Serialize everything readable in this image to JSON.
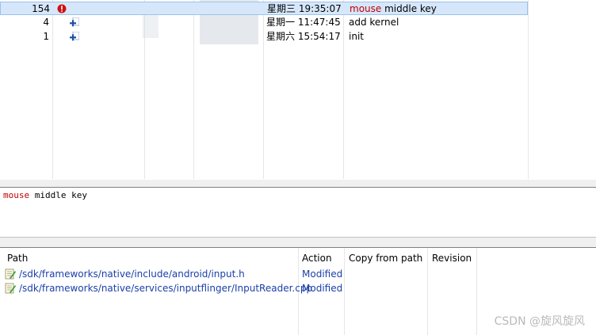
{
  "revisions": [
    {
      "number": "154",
      "icon": "error-icon",
      "date": "星期三 19:35:07",
      "message_keyword": "mouse",
      "message_rest": " middle key",
      "selected": true
    },
    {
      "number": "4",
      "icon": "add-icon",
      "date": "星期一 11:47:45",
      "message_keyword": "",
      "message_rest": "add kernel",
      "selected": false
    },
    {
      "number": "1",
      "icon": "add-icon",
      "date": "星期六 15:54:17",
      "message_keyword": "",
      "message_rest": "init",
      "selected": false
    }
  ],
  "log_message": {
    "keyword": "mouse",
    "rest": " middle key"
  },
  "paths_table": {
    "headers": {
      "path": "Path",
      "action": "Action",
      "copy_from_path": "Copy from path",
      "revision": "Revision"
    },
    "rows": [
      {
        "path": "/sdk/frameworks/native/include/android/input.h",
        "action": "Modified",
        "icon": "modified-file-icon"
      },
      {
        "path": "/sdk/frameworks/native/services/inputflinger/InputReader.cpp",
        "action": "Modified",
        "icon": "modified-file-icon"
      }
    ]
  },
  "watermark": "CSDN @旋风旋风",
  "colors": {
    "selection": "#d6e7fb",
    "keyword": "#c00000",
    "path_link": "#1a3fa8"
  }
}
